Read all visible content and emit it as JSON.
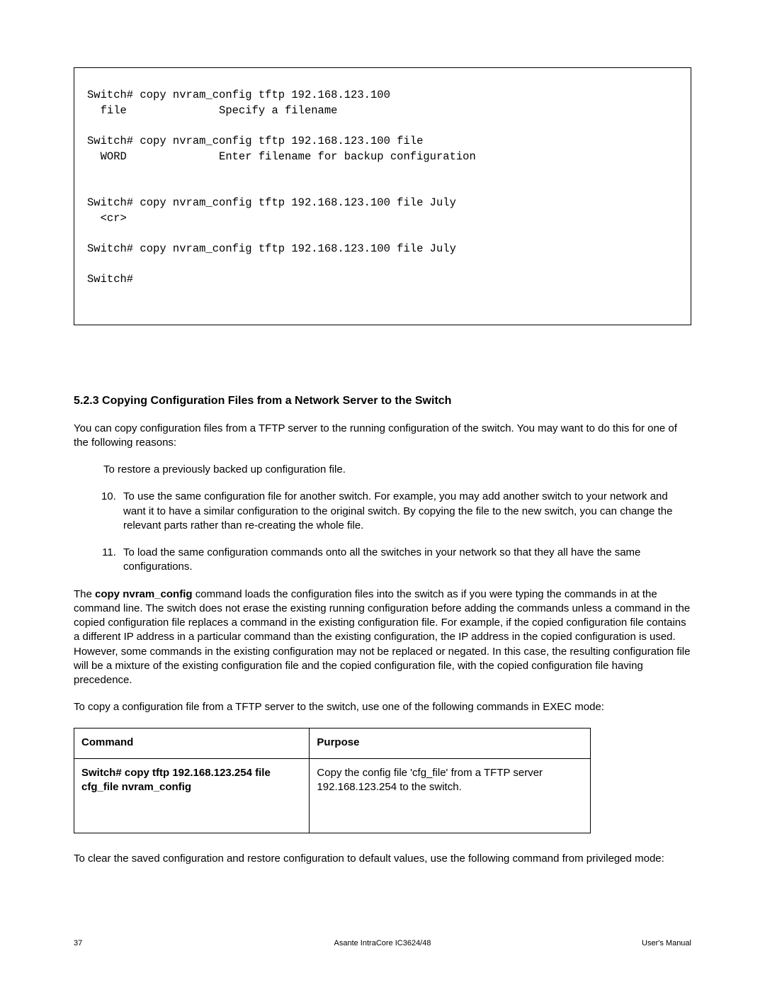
{
  "terminal": {
    "text": "Switch# copy nvram_config tftp 192.168.123.100\n  file              Specify a filename\n\nSwitch# copy nvram_config tftp 192.168.123.100 file\n  WORD              Enter filename for backup configuration\n\n\nSwitch# copy nvram_config tftp 192.168.123.100 file July\n  <cr>\n\nSwitch# copy nvram_config tftp 192.168.123.100 file July\n\nSwitch#"
  },
  "section": {
    "number": "5.2.3",
    "title": "Copying Configuration Files from a Network Server to the Switch"
  },
  "paragraphs": {
    "intro": "You can copy configuration files from a TFTP server to the running configuration of the switch. You may want to do this for one of the following reasons:",
    "restore": "To restore a previously backed up configuration file.",
    "list_start": 10,
    "list": [
      "To use the same configuration file for another switch. For example, you may add another switch to your network and want it to have a similar configuration to the original switch. By copying the file to the new switch, you can change the relevant parts rather than re-creating the whole file.",
      "To load the same configuration commands onto all the switches in your network so that they all have the same configurations."
    ],
    "cmd_name": "copy nvram_config",
    "explain_before": "The ",
    "explain_after": " command loads the configuration files into the switch as if you were typing the commands in at the command line. The switch does not erase the existing running configuration before adding the commands unless a command in the copied configuration file replaces a command in the existing configuration file. For example, if the copied configuration file contains a different IP address in a particular command than the existing configuration, the IP address in the copied configuration is used. However, some commands in the existing configuration may not be replaced or negated. In this case, the resulting configuration file will be a mixture of the existing configuration file and the copied configuration file, with the copied configuration file having precedence.",
    "lead_in": "To copy a configuration file from a TFTP server to the switch, use one of the following commands in EXEC mode:",
    "clear": "To clear the saved configuration and restore configuration to default values, use the following command from privileged mode:"
  },
  "table": {
    "headers": {
      "command": "Command",
      "purpose": "Purpose"
    },
    "row": {
      "command": "Switch# copy tftp 192.168.123.254 file cfg_file nvram_config",
      "purpose": "Copy the config file 'cfg_file' from a TFTP server 192.168.123.254 to the switch."
    }
  },
  "footer": {
    "page": "37",
    "center": "Asante IntraCore IC3624/48",
    "right": "User's Manual"
  }
}
